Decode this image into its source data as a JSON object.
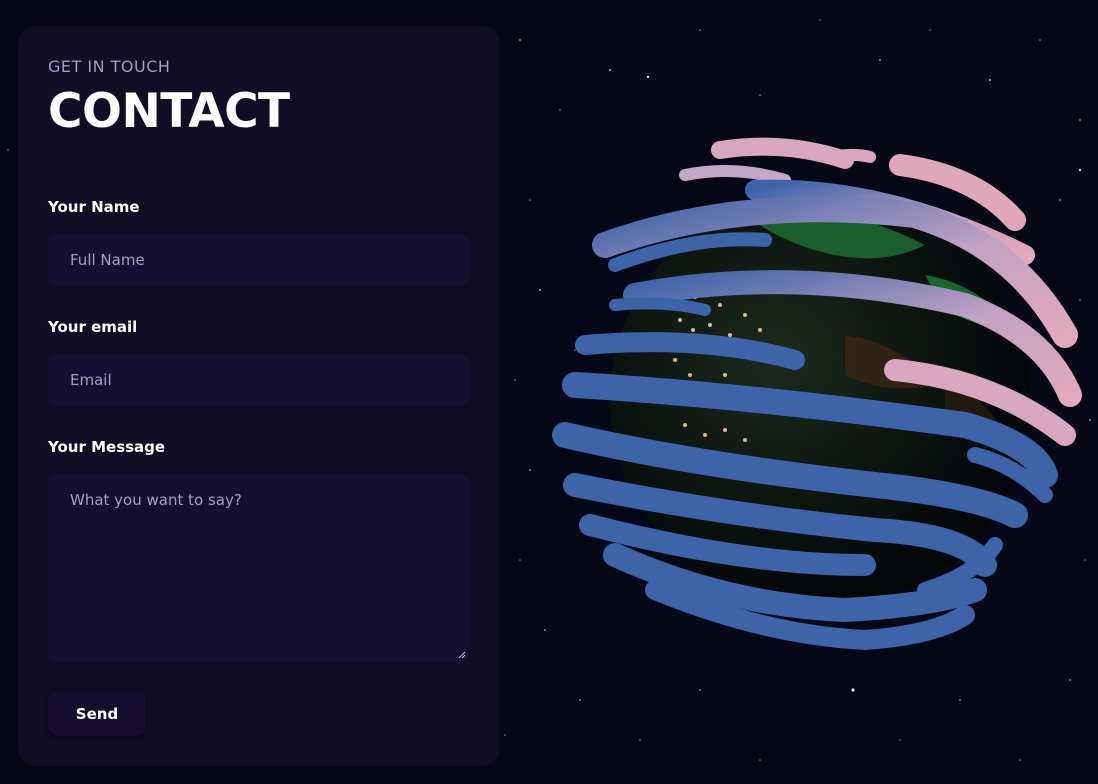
{
  "contact": {
    "eyebrow": "Get in touch",
    "title": "CONTACT",
    "name_label": "Your Name",
    "name_placeholder": "Full Name",
    "email_label": "Your email",
    "email_placeholder": "Email",
    "message_label": "Your Message",
    "message_placeholder": "What you want to say?",
    "send_label": "Send"
  },
  "colors": {
    "background": "#060818",
    "card": "#110d24",
    "field": "#161030",
    "placeholder": "#a39fc7",
    "ribbon_blue": "#3d64a8",
    "ribbon_pink": "#d9a8c0"
  },
  "icons": {
    "resize": "textarea-resize-icon",
    "globe": "earth-globe-image"
  }
}
